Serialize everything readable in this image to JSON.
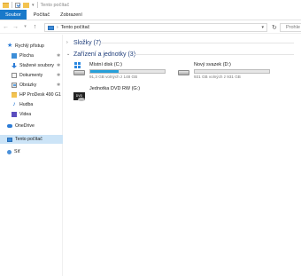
{
  "window": {
    "title": "Tento počítač"
  },
  "ribbon": {
    "tabs": [
      "Soubor",
      "Počítač",
      "Zobrazení"
    ]
  },
  "nav": {
    "back_icon": "arrow-left-icon",
    "forward_icon": "arrow-right-icon",
    "up_icon": "arrow-up-icon",
    "address": "Tento počítač",
    "search_placeholder": "Prohle"
  },
  "sidebar": {
    "items": [
      {
        "label": "Rychlý přístup",
        "icon": "star-icon",
        "pinned": false
      },
      {
        "label": "Plocha",
        "icon": "desktop-icon",
        "pinned": true
      },
      {
        "label": "Stažené soubory",
        "icon": "download-icon",
        "pinned": true
      },
      {
        "label": "Dokumenty",
        "icon": "documents-icon",
        "pinned": true
      },
      {
        "label": "Obrázky",
        "icon": "pictures-icon",
        "pinned": true
      },
      {
        "label": "HP ProDesk 490 G1",
        "icon": "folder-icon",
        "pinned": false
      },
      {
        "label": "Hudba",
        "icon": "music-icon",
        "pinned": false
      },
      {
        "label": "Videa",
        "icon": "video-icon",
        "pinned": false
      },
      {
        "label": "OneDrive",
        "icon": "onedrive-icon",
        "pinned": false
      },
      {
        "label": "Tento počítač",
        "icon": "pc-icon",
        "pinned": false,
        "selected": true
      },
      {
        "label": "Síť",
        "icon": "network-icon",
        "pinned": false
      }
    ],
    "pin_glyph": "✱"
  },
  "main": {
    "folders_group": {
      "title": "Složky (7)",
      "expanded": false
    },
    "devices_group": {
      "title": "Zařízení a jednotky (3)",
      "expanded": true
    },
    "drives": [
      {
        "name": "Místní disk (C:)",
        "info": "91,3 GB volných z 148 GB",
        "used_fraction": 0.38,
        "icon": "windows-drive-icon"
      },
      {
        "name": "Nový svazek (D:)",
        "info": "931 GB volných z 931 GB",
        "used_fraction": 0.0,
        "icon": "hard-drive-icon"
      },
      {
        "name": "Jednotka DVD RW (G:)",
        "icon": "dvd-drive-icon",
        "badge": "DVD"
      }
    ]
  },
  "colors": {
    "accent": "#1979ca",
    "selected": "#cce4f7",
    "bar_fill": "#26a0da",
    "group_title": "#1e3d7a"
  }
}
